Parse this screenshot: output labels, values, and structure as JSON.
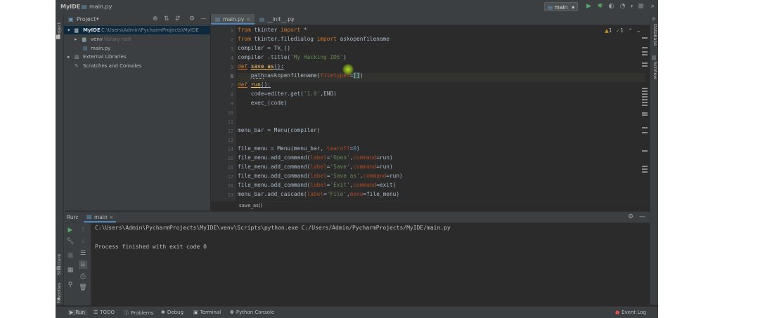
{
  "titlebar": {
    "app": "MyIDE",
    "file": "main.py",
    "run_config": "main"
  },
  "leftbar": {
    "project_label": "Project",
    "structure_label": "Structure",
    "favorites_label": "Favorites"
  },
  "rightbar": {
    "database_label": "Database",
    "sciview_label": "SciView"
  },
  "project_panel": {
    "title": "Project",
    "tree": [
      {
        "label": "MyIDE",
        "hint": "C:\\Users\\Admin\\PycharmProjects\\MyIDE",
        "indent": 1
      },
      {
        "label": "venv",
        "hint": "library root",
        "indent": 2
      },
      {
        "label": "main.py",
        "hint": "",
        "indent": 3
      },
      {
        "label": "External Libraries",
        "hint": "",
        "indent": 1
      },
      {
        "label": "Scratches and Consoles",
        "hint": "",
        "indent": 1
      }
    ]
  },
  "editor": {
    "tabs": [
      {
        "label": "main.py"
      },
      {
        "label": "__init__.py"
      }
    ],
    "inspection": {
      "warnings": "1",
      "weak": "1"
    },
    "breadcrumb": "save_as()",
    "lines": [
      {
        "n": "1"
      },
      {
        "n": "2"
      },
      {
        "n": "3"
      },
      {
        "n": "4"
      },
      {
        "n": "5"
      },
      {
        "n": "6"
      },
      {
        "n": "7"
      },
      {
        "n": "8"
      },
      {
        "n": "9"
      },
      {
        "n": "10"
      },
      {
        "n": "11"
      },
      {
        "n": "12"
      },
      {
        "n": "13"
      },
      {
        "n": "14"
      },
      {
        "n": "15"
      },
      {
        "n": "16"
      },
      {
        "n": "17"
      },
      {
        "n": "18"
      },
      {
        "n": "19"
      }
    ]
  },
  "run_panel": {
    "label": "Run:",
    "tab": "main",
    "output": [
      "C:\\Users\\Admin\\PycharmProjects\\MyIDE\\venv\\Scripts\\python.exe C:/Users/Admin/PycharmProjects/MyIDE/main.py",
      "Process finished with exit code 0"
    ]
  },
  "statusbar": {
    "items": [
      "Run",
      "TODO",
      "Problems",
      "Debug",
      "Terminal",
      "Python Console"
    ],
    "event_log": "Event Log"
  },
  "colors": {
    "background": "#2b2b2b",
    "panel": "#3c3f41",
    "keyword": "#cc7832",
    "string": "#6a8759",
    "number": "#6897bb",
    "param": "#aa4926",
    "run_green": "#59a869"
  }
}
